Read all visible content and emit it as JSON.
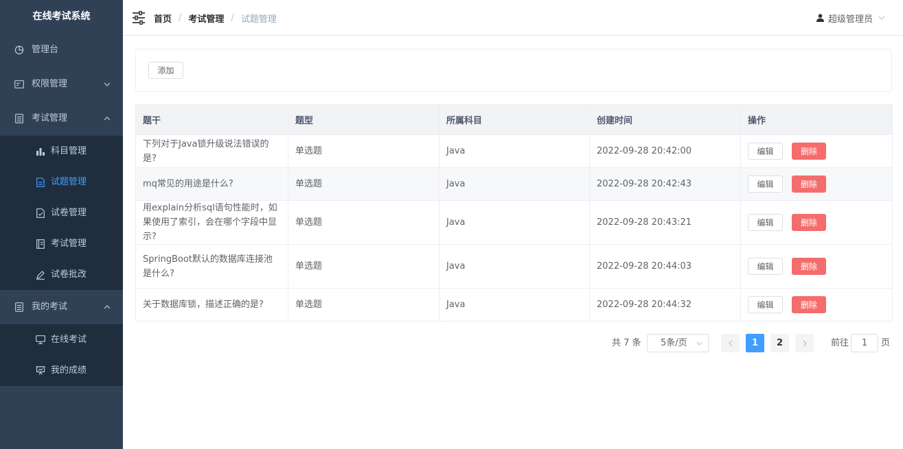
{
  "sidebar": {
    "title": "在线考试系统",
    "items": [
      {
        "label": "管理台"
      },
      {
        "label": "权限管理"
      },
      {
        "label": "考试管理",
        "children": [
          "科目管理",
          "试题管理",
          "试卷管理",
          "考试管理",
          "试卷批改"
        ]
      },
      {
        "label": "我的考试",
        "children": [
          "在线考试",
          "我的成绩"
        ]
      }
    ],
    "active": "试题管理",
    "active_color": "#409eff",
    "bg_color": "#304156"
  },
  "header": {
    "breadcrumb": [
      "首页",
      "考试管理",
      "试题管理"
    ],
    "separator": "/",
    "user": "超级管理员"
  },
  "toolbar": {
    "add_label": "添加"
  },
  "table": {
    "columns": [
      "题干",
      "题型",
      "所属科目",
      "创建时间",
      "操作"
    ],
    "rows": [
      {
        "stem": "下列对于Java锁升级说法错误的是?",
        "type": "单选题",
        "subject": "Java",
        "created": "2022-09-28 20:42:00"
      },
      {
        "stem": "mq常见的用途是什么?",
        "type": "单选题",
        "subject": "Java",
        "created": "2022-09-28 20:42:43"
      },
      {
        "stem": "用explain分析sql语句性能时，如果使用了索引，会在哪个字段中显示?",
        "type": "单选题",
        "subject": "Java",
        "created": "2022-09-28 20:43:21"
      },
      {
        "stem": "SpringBoot默认的数据库连接池是什么?",
        "type": "单选题",
        "subject": "Java",
        "created": "2022-09-28 20:44:03"
      },
      {
        "stem": "关于数据库锁，描述正确的是?",
        "type": "单选题",
        "subject": "Java",
        "created": "2022-09-28 20:44:32"
      }
    ],
    "edit_label": "编辑",
    "delete_label": "删除",
    "delete_color": "#f56c6c"
  },
  "pagination": {
    "total_text": "共 7 条",
    "page_size": "5条/页",
    "pages": [
      "1",
      "2"
    ],
    "current": "1",
    "goto_label": "前往",
    "goto_value": "1",
    "page_suffix": "页"
  }
}
